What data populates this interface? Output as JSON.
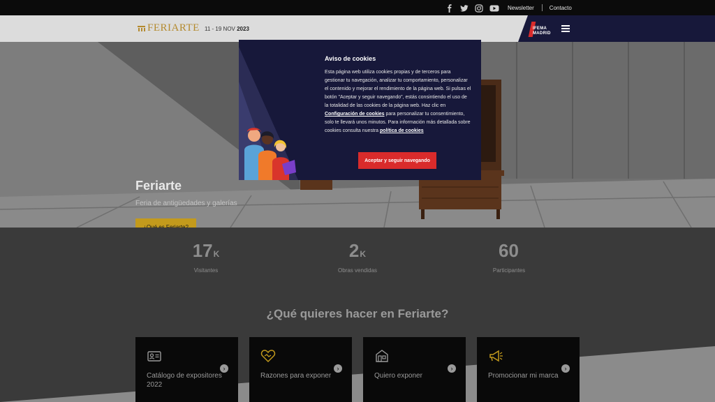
{
  "topbar": {
    "social": [
      {
        "name": "facebook-icon",
        "glyph": "f"
      },
      {
        "name": "twitter-icon",
        "glyph": "t"
      },
      {
        "name": "instagram-icon",
        "glyph": "i"
      },
      {
        "name": "youtube-icon",
        "glyph": "y"
      }
    ],
    "newsletter": "Newsletter",
    "contacto": "Contacto"
  },
  "header": {
    "logo_text": "FERIARTE",
    "dates_prefix": "11 - 19 NOV",
    "dates_year": "2023",
    "ifema_line1": "IFEMA",
    "ifema_line2": "MADRID"
  },
  "hero": {
    "title": "Feriarte",
    "subtitle": "Feria de antigüedades y galerías",
    "button": "¿Qué es Feriarte?"
  },
  "stats": [
    {
      "value": "17",
      "suffix": "K",
      "label": "Visitantes"
    },
    {
      "value": "2",
      "suffix": "K",
      "label": "Obras vendidas"
    },
    {
      "value": "60",
      "suffix": "",
      "label": "Participantes"
    }
  ],
  "question": "¿Qué quieres hacer en Feriarte?",
  "cards": [
    {
      "label": "Catálogo de expositores 2022",
      "icon": "id-card-icon"
    },
    {
      "label": "Razones para exponer",
      "icon": "heart-handshake-icon"
    },
    {
      "label": "Quiero exponer",
      "icon": "stand-icon"
    },
    {
      "label": "Promocionar mi marca",
      "icon": "megaphone-icon"
    }
  ],
  "cookie": {
    "title": "Aviso de cookies",
    "text_1": "Esta página web utiliza cookies propias y de terceros para gestionar tu navegación, analizar tu comportamiento, personalizar el contenido y mejorar el rendimiento de la página web. Si pulsas el botón \"Aceptar y seguir navegando\", estás consintiendo el uso de la totalidad de las cookies de la página web. Haz clic en ",
    "link_config": "Configuración de cookies",
    "text_2": " para personalizar tu consentimiento, solo te llevará unos minutos. Para información más detallada sobre cookies consulta nuestra ",
    "link_policy": "política de cookies",
    "accept_button": "Aceptar y seguir navegando"
  },
  "colors": {
    "gold": "#c39a1c",
    "navy": "#17183a",
    "red": "#d92b2b"
  }
}
